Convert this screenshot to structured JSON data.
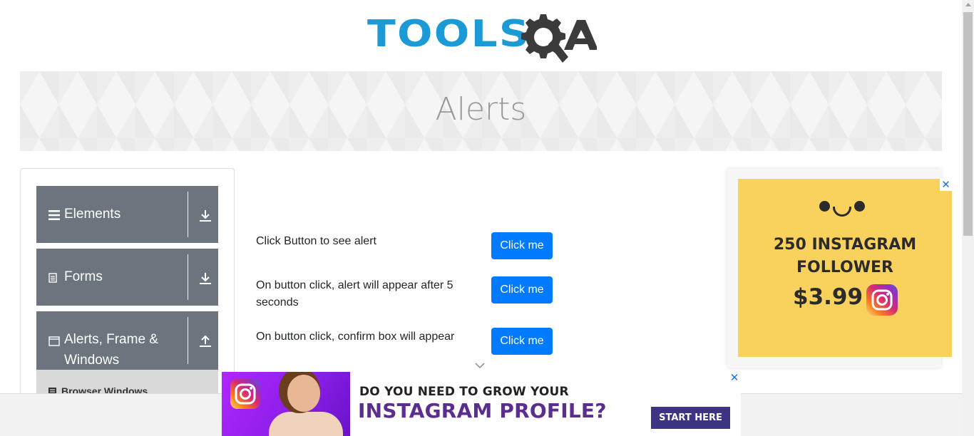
{
  "logo": {
    "text_tools": "TOOLS",
    "text_qa": "QA",
    "colors": {
      "tools": "#1b9ad6",
      "qa": "#3b3b3b"
    }
  },
  "banner": {
    "title": "Alerts"
  },
  "nav": {
    "groups": [
      {
        "label": "Elements",
        "icon": "hamburger-icon",
        "toggle_icon": "download-arrow-icon"
      },
      {
        "label": "Forms",
        "icon": "document-icon",
        "toggle_icon": "download-arrow-icon"
      },
      {
        "label": "Alerts, Frame &\nWindows",
        "icon": "window-icon",
        "toggle_icon": "upload-arrow-icon"
      }
    ],
    "subitems": [
      {
        "label": "Browser Windows",
        "icon": "html-file-icon"
      }
    ]
  },
  "main": {
    "rows": [
      {
        "label": "Click Button to see alert",
        "button": "Click me"
      },
      {
        "label": "On button click, alert will appear after 5 seconds",
        "button": "Click me"
      },
      {
        "label": "On button click, confirm box will appear",
        "button": "Click me"
      }
    ]
  },
  "ad_right": {
    "line1": "250 INSTAGRAM",
    "line2": "FOLLOWER",
    "price": "$3.99",
    "close": "✕",
    "bg_color": "#f8d25c"
  },
  "ad_bottom": {
    "line1": "DO YOU NEED TO GROW YOUR",
    "line2": "INSTAGRAM PROFILE?",
    "cta": "START HERE",
    "close": "✕"
  },
  "colors": {
    "accent": "#007bff",
    "nav_bg": "#6c757d",
    "sub_bg": "#d9d9d9"
  }
}
